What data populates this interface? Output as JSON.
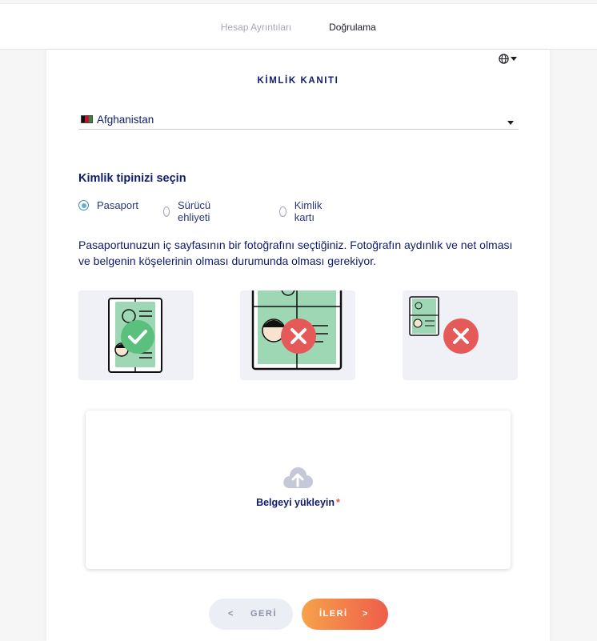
{
  "tabs": [
    {
      "label": "Hesap Ayrıntıları"
    },
    {
      "label": "Doğrulama"
    }
  ],
  "title": "KİMLİK KANITI",
  "country": {
    "selected": "Afghanistan"
  },
  "id_type": {
    "heading": "Kimlik tipinizi seçin",
    "options": [
      {
        "label": "Pasaport"
      },
      {
        "label": "Sürücü ehliyeti"
      },
      {
        "label": "Kimlik kartı"
      }
    ],
    "selected": "Pasaport"
  },
  "instructions": "Pasaportunuzun iç sayfasının bir fotoğrafını seçtiğiniz. Fotoğrafın aydınlık ve net olması ve belgenin köşelerinin olması durumunda olması gerekiyor.",
  "upload": {
    "label": "Belgeyi yükleyin",
    "required_marker": "*"
  },
  "buttons": {
    "back_chevron": "<",
    "back": "GERİ",
    "next": "İLERİ",
    "next_chevron": ">"
  },
  "icons": {
    "language": "globe-icon",
    "upload": "cloud-upload-icon",
    "good_example": "check-circle-icon",
    "bad_example": "x-circle-icon"
  },
  "colors": {
    "primary_text": "#0f1d6b",
    "radio_selected": "#5cb2d6",
    "success": "#5bbf7e",
    "error": "#e55a58",
    "next_gradient_start": "#f6a24a",
    "next_gradient_end": "#ee5d4a"
  }
}
